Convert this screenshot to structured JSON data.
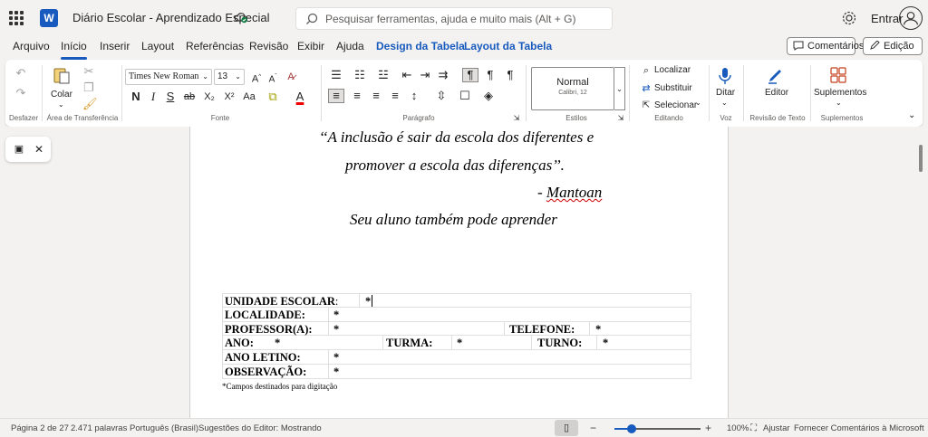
{
  "app": {
    "title": "Diário Escolar - Aprendizado Especial",
    "search_placeholder": "Pesquisar ferramentas, ajuda e muito mais (Alt + G)",
    "signin_label": "Entrar",
    "accent_color": "#185abd"
  },
  "menu": {
    "tabs": [
      "Arquivo",
      "Início",
      "Inserir",
      "Layout",
      "Referências",
      "Revisão",
      "Exibir",
      "Ajuda",
      "Design da Tabela",
      "Layout da Tabela"
    ],
    "active_tab": "Início",
    "comments_label": "Comentários",
    "edit_label": "Edição"
  },
  "ribbon": {
    "undo_label": "Desfazer",
    "paste_label": "Colar",
    "clipboard_label": "Área de Transferência",
    "font_name": "Times New Roman",
    "font_size": "13",
    "font_group_label": "Fonte",
    "paragraph_label": "Parágrafo",
    "style_name": "Normal",
    "style_sub": "Calibri, 12",
    "styles_label": "Estilos",
    "find_label": "Localizar",
    "replace_label": "Substituir",
    "select_label": "Selecionar",
    "editing_label": "Editando",
    "dictate_label": "Ditar",
    "voice_label": "Voz",
    "editor_label": "Editor",
    "text_review_label": "Revisão de Texto",
    "addins_label": "Suplementos",
    "addins_group_label": "Suplementos"
  },
  "document": {
    "quote_line1": "‘‘A inclusão é sair da escola dos diferentes e",
    "quote_line2": "promover a escola das diferenças’’.",
    "author_dash": "- ",
    "author": "Mantoan",
    "tagline": "Seu aluno também pode aprender",
    "form": {
      "unidade_label": "UNIDADE ESCOLAR",
      "unidade_colon": ":",
      "localidade_label": "LOCALIDADE:",
      "professor_label": "PROFESSOR(A):",
      "telefone_label": "TELEFONE:",
      "ano_label": "ANO:",
      "turma_label": "TURMA:",
      "turno_label": "TURNO:",
      "ano_letivo_label": "ANO LETINO:",
      "observacao_label": "OBSERVAÇÃO:",
      "marker": "*"
    },
    "footnote": "*Campos destinados para digitação"
  },
  "status": {
    "page": "Página 2 de 27",
    "words": "2.471 palavras",
    "language": "Português (Brasil)",
    "editor_suggestions": "Sugestões do Editor: Mostrando",
    "zoom_minus": "−",
    "zoom_plus": "+",
    "zoom_level": "100%",
    "zoom_fraction": 0.2,
    "fit_label": "Ajustar",
    "feedback_label": "Fornecer Comentários à Microsoft"
  }
}
